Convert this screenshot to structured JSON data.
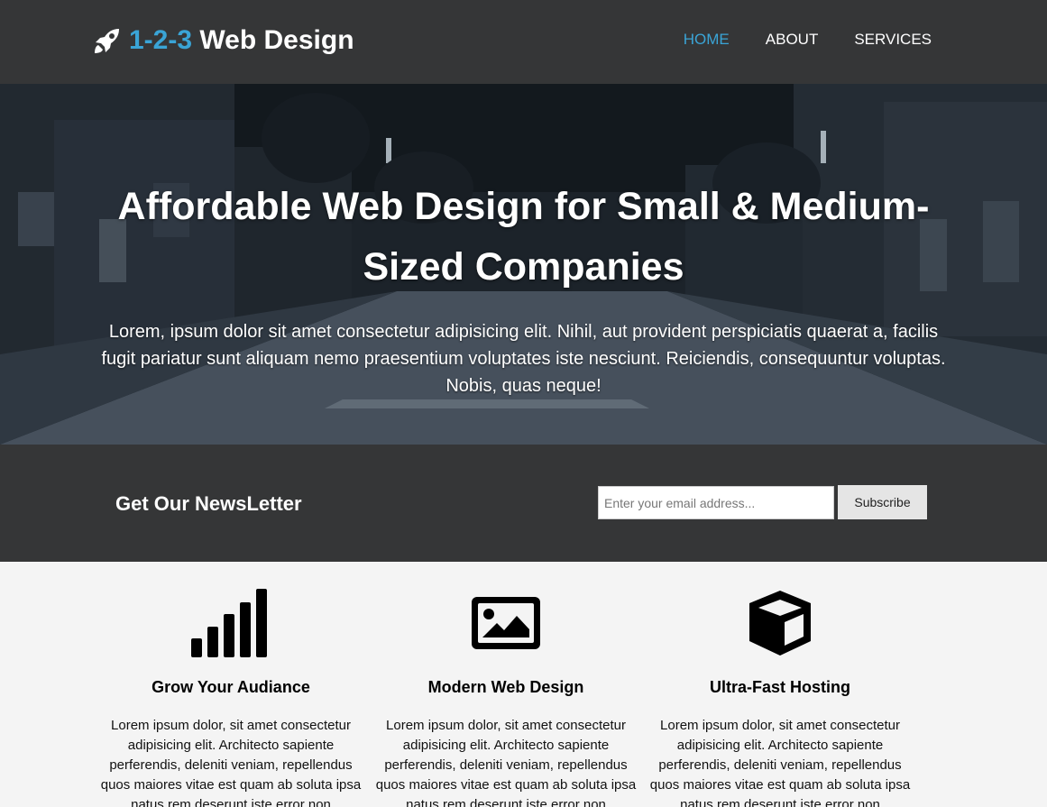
{
  "header": {
    "brand_accent": "1-2-3",
    "brand_rest": " Web Design",
    "logo_icon": "rocket-icon",
    "nav": [
      "HOME",
      "ABOUT",
      "SERVICES"
    ],
    "active_nav": "HOME"
  },
  "hero": {
    "heading": "Affordable Web Design for Small & Medium-Sized Companies",
    "text": "Lorem, ipsum dolor sit amet consectetur adipisicing elit. Nihil, aut provident perspiciatis quaerat a, facilis fugit pariatur sunt aliquam nemo praesentium voluptates iste nesciunt. Reiciendis, consequuntur voluptas. Nobis, quas neque!"
  },
  "newsletter": {
    "title": "Get Our NewsLetter",
    "email_placeholder": "Enter your email address...",
    "email_value": "",
    "subscribe_label": "Subscribe"
  },
  "features": [
    {
      "icon": "signal-bars-icon",
      "title": "Grow Your Audiance",
      "text": "Lorem ipsum dolor, sit amet consectetur adipisicing elit. Architecto sapiente perferendis, deleniti veniam, repellendus quos maiores vitae est quam ab soluta ipsa natus rem deserunt iste error non"
    },
    {
      "icon": "image-icon",
      "title": "Modern Web Design",
      "text": "Lorem ipsum dolor, sit amet consectetur adipisicing elit. Architecto sapiente perferendis, deleniti veniam, repellendus quos maiores vitae est quam ab soluta ipsa natus rem deserunt iste error non"
    },
    {
      "icon": "cube-icon",
      "title": "Ultra-Fast Hosting",
      "text": "Lorem ipsum dolor, sit amet consectetur adipisicing elit. Architecto sapiente perferendis, deleniti veniam, repellendus quos maiores vitae est quam ab soluta ipsa natus rem deserunt iste error non"
    }
  ],
  "colors": {
    "header_bg": "#353637",
    "accent": "#3aa4d6",
    "features_bg": "#f4f4f4"
  }
}
